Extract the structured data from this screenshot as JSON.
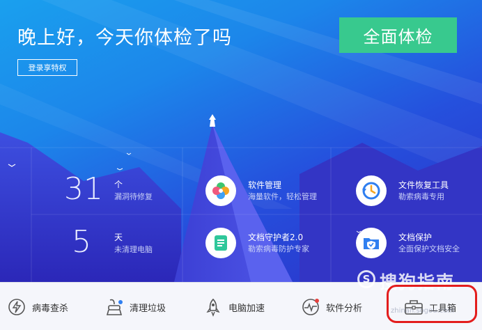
{
  "header": {
    "greeting": "晚上好，今天你体检了吗",
    "login_label": "登录享特权",
    "checkup_label": "全面体检"
  },
  "stats": [
    {
      "value": "31",
      "unit": "个",
      "desc": "漏洞待修复"
    },
    {
      "value": "5",
      "unit": "天",
      "desc": "未清理电脑"
    }
  ],
  "tools": [
    {
      "title": "软件管理",
      "desc": "海量软件，轻松管理",
      "icon": "clover-icon"
    },
    {
      "title": "文件恢复工具",
      "desc": "勒索病毒专用",
      "icon": "clock-restore-icon"
    },
    {
      "title": "文档守护者2.0",
      "desc": "勒索病毒防护专家",
      "icon": "document-icon"
    },
    {
      "title": "文档保护",
      "desc": "全面保护文档安全",
      "icon": "shield-folder-icon"
    }
  ],
  "bottom_bar": [
    {
      "label": "病毒查杀",
      "icon": "lightning-shield-icon"
    },
    {
      "label": "清理垃圾",
      "icon": "broom-icon"
    },
    {
      "label": "电脑加速",
      "icon": "rocket-icon"
    },
    {
      "label": "软件分析",
      "icon": "pulse-icon"
    },
    {
      "label": "工具箱",
      "icon": "toolbox-icon"
    }
  ],
  "watermark": {
    "mark": "S",
    "text": "搜狗指南",
    "sub": "zhinan.sogou.com"
  },
  "colors": {
    "accent_green": "#38c98e",
    "highlight_red": "#e31d1d",
    "icon_blue": "#2f7ff0"
  }
}
